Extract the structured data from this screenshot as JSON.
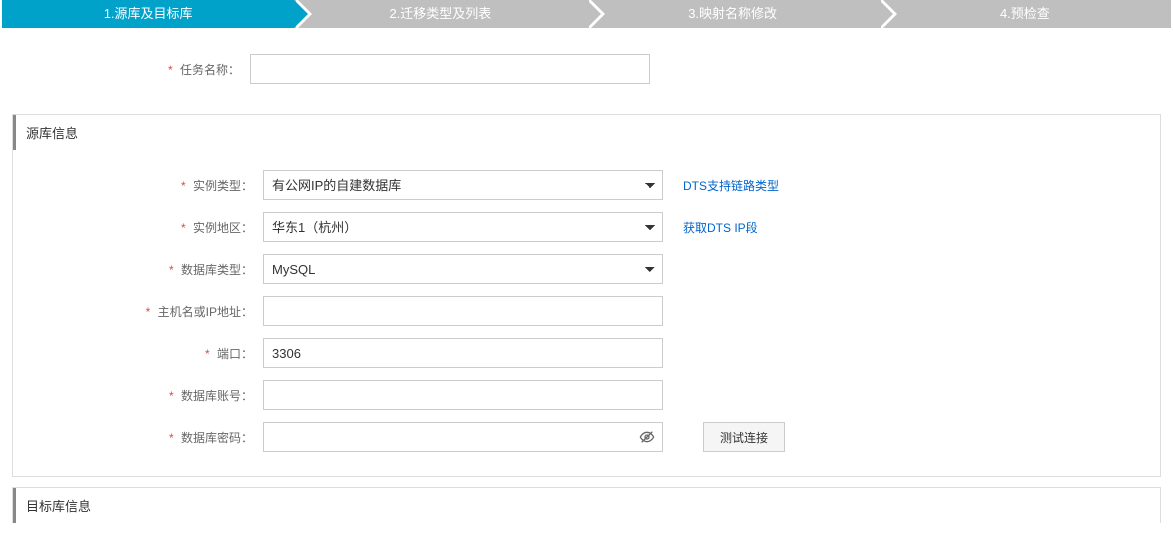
{
  "steps": {
    "items": [
      {
        "label": "1.源库及目标库"
      },
      {
        "label": "2.迁移类型及列表"
      },
      {
        "label": "3.映射名称修改"
      },
      {
        "label": "4.预检查"
      }
    ],
    "activeIndex": 0
  },
  "taskName": {
    "label": "任务名称：",
    "value": ""
  },
  "sourceSection": {
    "title": "源库信息",
    "instanceType": {
      "label": "实例类型：",
      "value": "有公网IP的自建数据库",
      "link": "DTS支持链路类型"
    },
    "region": {
      "label": "实例地区：",
      "value": "华东1（杭州）",
      "link": "获取DTS IP段"
    },
    "dbType": {
      "label": "数据库类型：",
      "value": "MySQL"
    },
    "host": {
      "label": "主机名或IP地址：",
      "value": ""
    },
    "port": {
      "label": "端口：",
      "value": "3306"
    },
    "account": {
      "label": "数据库账号：",
      "value": ""
    },
    "password": {
      "label": "数据库密码：",
      "value": "",
      "testButton": "测试连接"
    }
  },
  "targetSection": {
    "title": "目标库信息"
  }
}
